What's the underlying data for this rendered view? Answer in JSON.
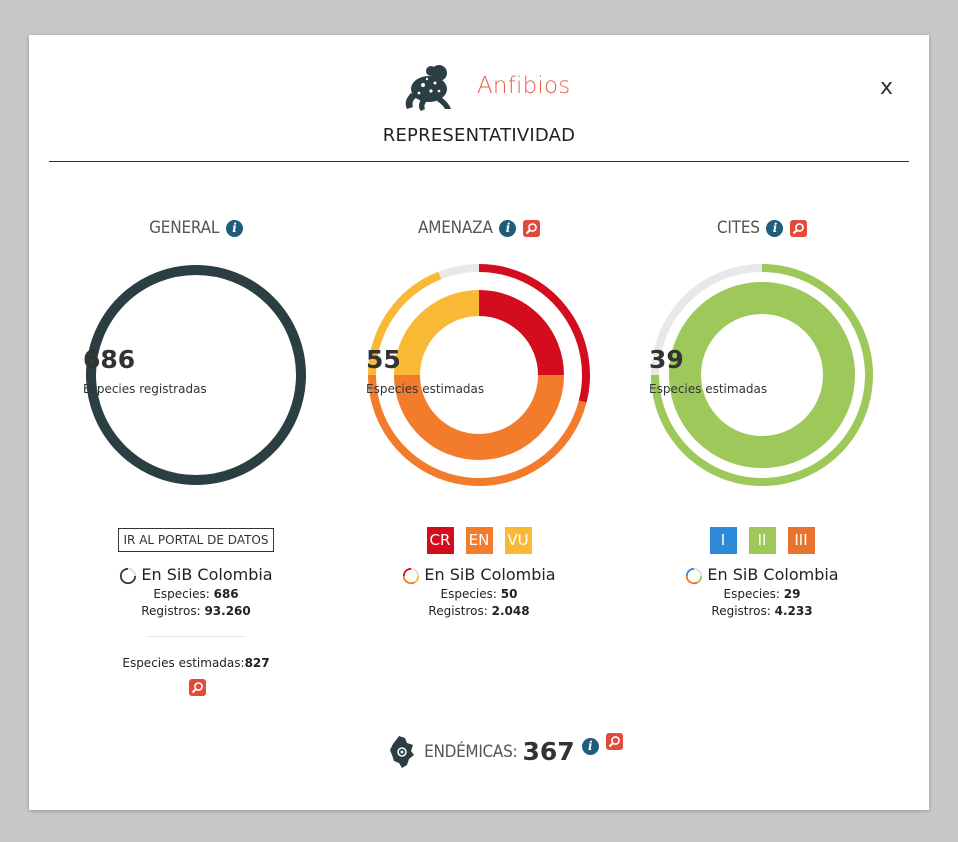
{
  "header": {
    "title": "Anfibios",
    "subtitle": "REPRESENTATIVIDAD",
    "close_label": "x",
    "icon": "frog-icon"
  },
  "general": {
    "heading": "GENERAL",
    "number": "686",
    "caption": "Especies registradas",
    "portal_button": "IR AL PORTAL DE DATOS",
    "sib_label": "En SiB Colombia",
    "especies_label": "Especies:",
    "especies_value": "686",
    "registros_label": "Registros:",
    "registros_value": "93.260",
    "estimadas_label": "Especies estimadas:",
    "estimadas_value": "827",
    "ring_color": "#2b3e42"
  },
  "amenaza": {
    "heading": "AMENAZA",
    "number": "55",
    "caption": "Especies estimadas",
    "tags": [
      {
        "label": "CR",
        "color": "#d40d1e"
      },
      {
        "label": "EN",
        "color": "#f27c2c"
      },
      {
        "label": "VU",
        "color": "#f9b935"
      }
    ],
    "sib_label": "En SiB Colombia",
    "especies_label": "Especies:",
    "especies_value": "50",
    "registros_label": "Registros:",
    "registros_value": "2.048"
  },
  "cites": {
    "heading": "CITES",
    "number": "39",
    "caption": "Especies estimadas",
    "tags": [
      {
        "label": "I",
        "color": "#2d8ad9"
      },
      {
        "label": "II",
        "color": "#9fc85a"
      },
      {
        "label": "III",
        "color": "#e8732f"
      }
    ],
    "sib_label": "En SiB Colombia",
    "especies_label": "Especies:",
    "especies_value": "29",
    "registros_label": "Registros:",
    "registros_value": "4.233"
  },
  "endemicas": {
    "label": "ENDÉMICAS:",
    "value": "367",
    "icon": "colombia-map-icon"
  },
  "chart_data": [
    {
      "type": "pie",
      "name_shown": "GENERAL",
      "value": 686,
      "caption": "Especies registradas"
    },
    {
      "type": "pie",
      "name_shown": "AMENAZA",
      "total": 55,
      "caption": "Especies estimadas",
      "categories": [
        "CR",
        "EN",
        "VU"
      ],
      "inner_fractions": [
        0.25,
        0.5,
        0.25
      ],
      "outer_fractions": [
        0.29,
        0.46,
        0.19
      ],
      "outer_missing_fraction": 0.06
    },
    {
      "type": "pie",
      "name_shown": "CITES",
      "total": 39,
      "caption": "Especies estimadas",
      "categories": [
        "I",
        "II",
        "III"
      ],
      "inner_fractions": [
        0,
        1,
        0
      ],
      "outer_fractions": [
        0,
        0.75,
        0
      ],
      "outer_missing_fraction": 0.25
    }
  ]
}
